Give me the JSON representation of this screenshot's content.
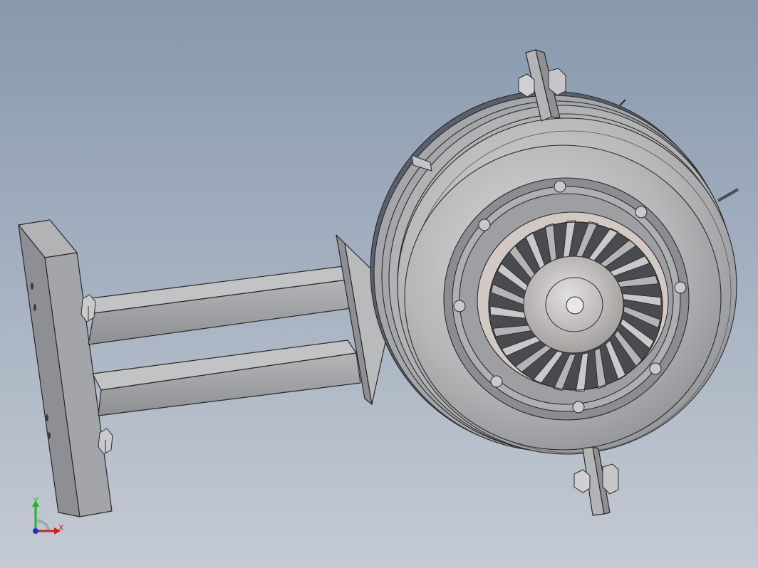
{
  "viewport": {
    "background_top": "#8799ad",
    "background_bottom": "#c4cad3"
  },
  "model": {
    "parts": [
      "mounting-plate",
      "support-arm",
      "mounting-bracket",
      "turbine-housing",
      "turbine-blades",
      "turbine-hub",
      "clamp-tab",
      "hex-bolt",
      "screw"
    ],
    "colors": {
      "body": "#b9b9bb",
      "dark_edge": "#2a2a2a",
      "plate": "#9c9ea0",
      "blade": "#c4c4c6"
    }
  },
  "triad": {
    "x_label": "X",
    "y_label": "Y",
    "x_color": "#d02020",
    "y_color": "#1fb81f",
    "z_color": "#2030c8"
  }
}
